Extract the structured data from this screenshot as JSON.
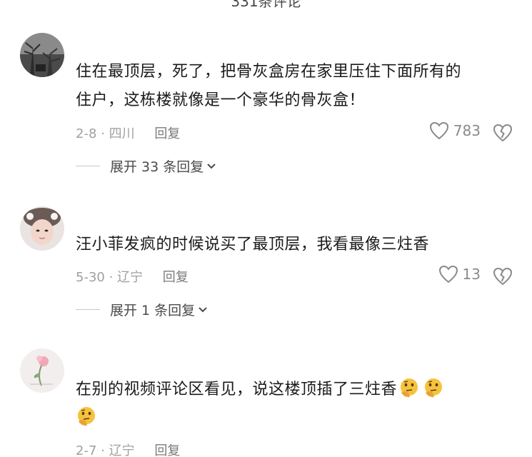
{
  "header": {
    "title": "331条评论"
  },
  "comments": [
    {
      "username": "",
      "text_line1": "住在最顶层，死了，把骨灰盒房在家里压住下面所有的",
      "text_line2": "住户，这栋楼就像是一个豪华的骨灰盒！",
      "date_location": "2-8 · 四川",
      "reply_label": "回复",
      "likes": "783",
      "expand_label": "展开 33 条回复"
    },
    {
      "username": "",
      "text_line1": "汪小菲发疯的时候说买了最顶层，我看最像三炷香",
      "date_location": "5-30 · 辽宁",
      "reply_label": "回复",
      "likes": "13",
      "expand_label": "展开 1 条回复"
    },
    {
      "username": "",
      "text_line1": "在别的视频评论区看见，说这楼顶插了三炷香",
      "emoji_name": "thinking-face-icon",
      "date_location": "2-7 · 辽宁",
      "reply_label": "回复"
    }
  ],
  "icons": {
    "like": "heart-outline-icon",
    "dislike": "broken-heart-icon",
    "expand": "chevron-down-icon"
  },
  "colors": {
    "text": "#1a1a1a",
    "meta": "#a0a0a0",
    "icon": "#8a8a8a"
  }
}
